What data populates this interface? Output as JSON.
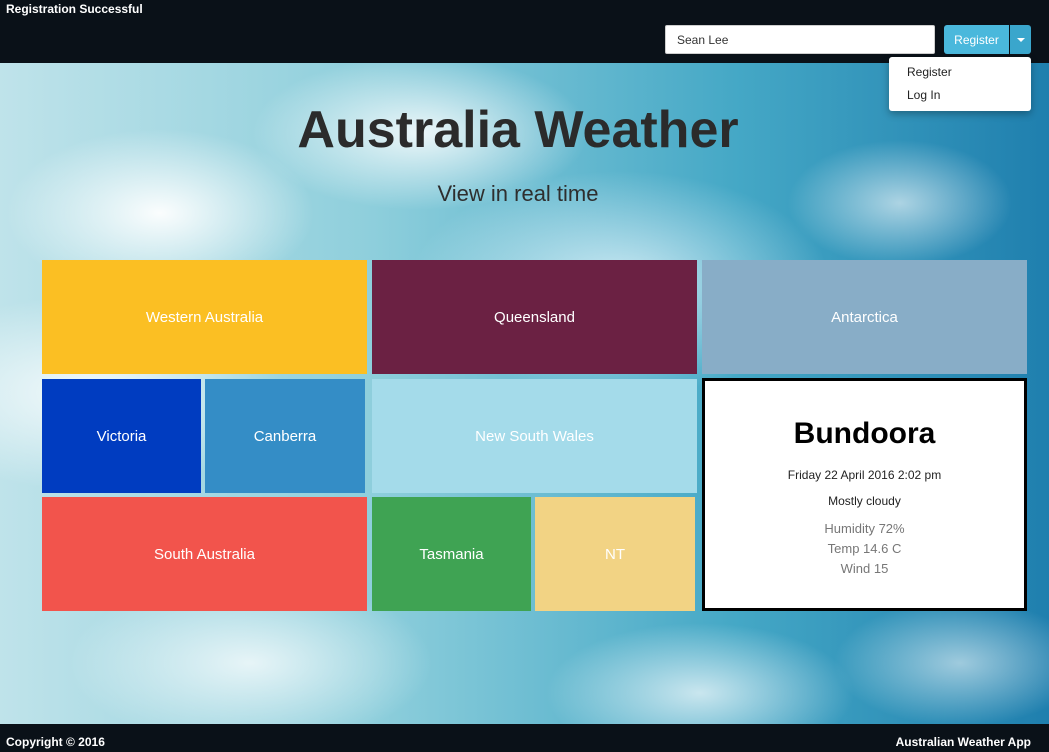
{
  "status": {
    "message": "Registration Successful"
  },
  "header": {
    "name_input_value": "Sean Lee",
    "register_button_label": "Register",
    "dropdown": {
      "items": [
        {
          "label": "Register"
        },
        {
          "label": "Log In"
        }
      ]
    }
  },
  "hero": {
    "title": "Australia Weather",
    "subtitle": "View in real time"
  },
  "regions": [
    {
      "label": "Western Australia",
      "color": "#fbbf23"
    },
    {
      "label": "Queensland",
      "color": "#6b2143"
    },
    {
      "label": "Antarctica",
      "color": "#88adc7"
    },
    {
      "label": "Victoria",
      "color": "#003cc0"
    },
    {
      "label": "Canberra",
      "color": "#348dc6"
    },
    {
      "label": "New South Wales",
      "color": "#a4dbea"
    },
    {
      "label": "South Australia",
      "color": "#f2544c"
    },
    {
      "label": "Tasmania",
      "color": "#3fa353"
    },
    {
      "label": "NT",
      "color": "#f2d384"
    }
  ],
  "weather": {
    "city": "Bundoora",
    "datetime": "Friday 22 April 2016 2:02 pm",
    "condition": "Mostly cloudy",
    "humidity": "Humidity 72%",
    "temp": "Temp 14.6 C",
    "wind": "Wind 15"
  },
  "footer": {
    "copyright": "Copyright © 2016",
    "app_name": "Australian Weather App"
  }
}
